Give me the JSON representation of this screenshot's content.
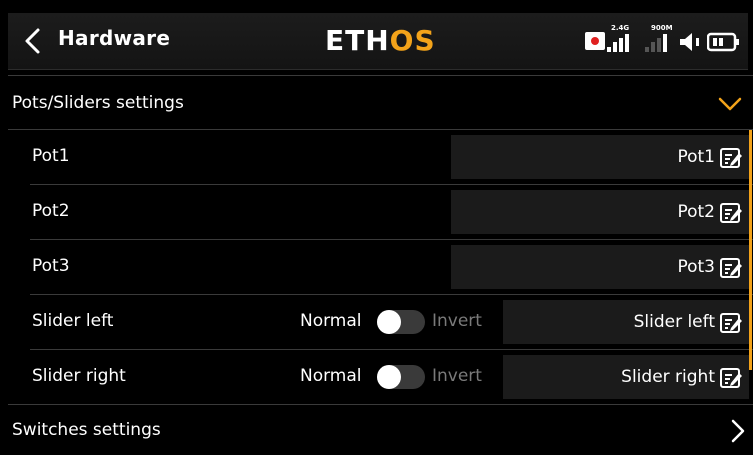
{
  "header": {
    "title": "Hardware",
    "logo_part1": "ETH",
    "logo_part2": "OS",
    "signal_label_1": "2.4G",
    "signal_label_2": "900M"
  },
  "sections": {
    "pots": {
      "label": "Pots/Sliders settings",
      "state": "expanded"
    },
    "switches": {
      "label": "Switches settings",
      "state": "collapsed"
    }
  },
  "rows": [
    {
      "label": "Pot1",
      "value": "Pot1"
    },
    {
      "label": "Pot2",
      "value": "Pot2"
    },
    {
      "label": "Pot3",
      "value": "Pot3"
    },
    {
      "label": "Slider left",
      "value": "Slider left",
      "normal": "Normal",
      "invert": "Invert",
      "inverted": false
    },
    {
      "label": "Slider right",
      "value": "Slider right",
      "normal": "Normal",
      "invert": "Invert",
      "inverted": false
    }
  ],
  "colors": {
    "accent": "#f3a31a",
    "background": "#000000",
    "field": "#1b1b1b",
    "divider": "#3a3a3a",
    "record": "#e02020"
  }
}
